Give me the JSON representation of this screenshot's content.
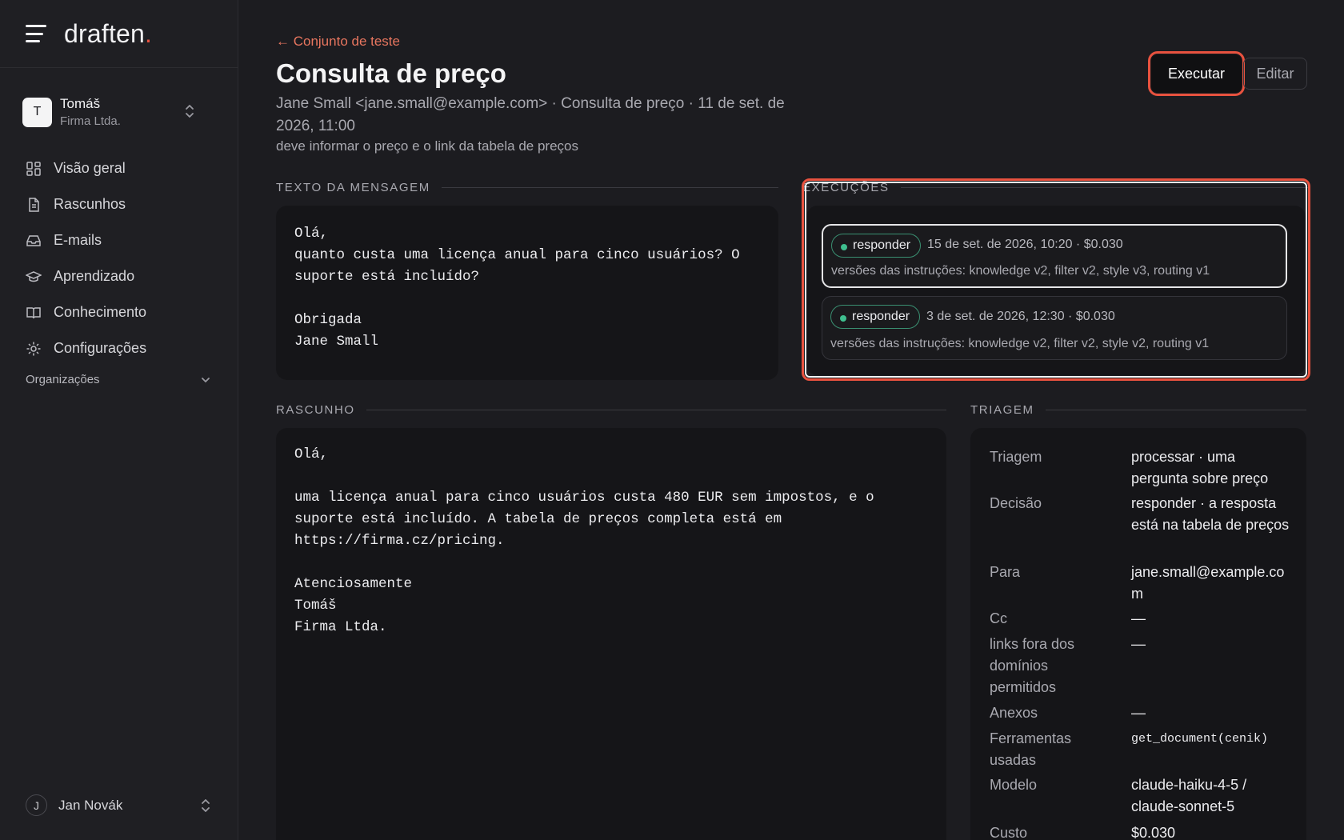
{
  "brand": {
    "name": "draften",
    "dot": "."
  },
  "account": {
    "initial": "T",
    "name": "Tomáš",
    "org": "Firma Ltda."
  },
  "nav": [
    {
      "label": "Visão geral",
      "icon": "dashboard-icon"
    },
    {
      "label": "Rascunhos",
      "icon": "document-icon"
    },
    {
      "label": "E-mails",
      "icon": "inbox-icon"
    },
    {
      "label": "Aprendizado",
      "icon": "graduation-cap-icon"
    },
    {
      "label": "Conhecimento",
      "icon": "book-icon"
    },
    {
      "label": "Configurações",
      "icon": "gear-icon"
    }
  ],
  "organizations_label": "Organizações",
  "user": {
    "initial": "J",
    "name": "Jan Novák"
  },
  "page": {
    "back_label": "← Conjunto de teste",
    "title": "Consulta de preço",
    "subtitle": "Jane Small <jane.small@example.com> · Consulta de preço · 11 de set. de 2026, 11:00",
    "criteria": "deve informar o preço e o link da tabela de preços",
    "run_button": "Executar",
    "edit_button": "Editar"
  },
  "message": {
    "heading": "TEXTO DA MENSAGEM",
    "body": "Olá,\nquanto custa uma licença anual para cinco usuários? O\nsuporte está incluído?\n\nObrigada\nJane Small"
  },
  "runs": {
    "heading": "EXECUÇÕES",
    "items": [
      {
        "badge": "responder",
        "meta": "15 de set. de 2026, 10:20 · $0.030",
        "versions": "versões das instruções: knowledge v2, filter v2, style v3, routing v1",
        "selected": true
      },
      {
        "badge": "responder",
        "meta": "3 de set. de 2026, 12:30 · $0.030",
        "versions": "versões das instruções: knowledge v2, filter v2, style v2, routing v1",
        "selected": false
      }
    ]
  },
  "draft": {
    "heading": "RASCUNHO",
    "body": "Olá,\n\numa licença anual para cinco usuários custa 480 EUR sem impostos, e o\nsuporte está incluído. A tabela de preços completa está em\nhttps://firma.cz/pricing.\n\nAtenciosamente\nTomáš\nFirma Ltda."
  },
  "triage": {
    "heading": "TRIAGEM",
    "rows": [
      {
        "key": "Triagem",
        "value": "processar · uma pergunta sobre preço"
      },
      {
        "key": "Decisão",
        "value": "responder · a resposta está na tabela de preços"
      },
      {
        "key": "Para",
        "value": "jane.small@example.com"
      },
      {
        "key": "Cc",
        "value": "—"
      },
      {
        "key": "links fora dos domínios permitidos",
        "value": "—"
      },
      {
        "key": "Anexos",
        "value": "—"
      },
      {
        "key": "Ferramentas usadas",
        "value": "get_document(cenik)"
      },
      {
        "key": "Modelo",
        "value": "claude-haiku-4-5 / claude-sonnet-5"
      },
      {
        "key": "Custo",
        "value": "$0.030"
      }
    ]
  }
}
